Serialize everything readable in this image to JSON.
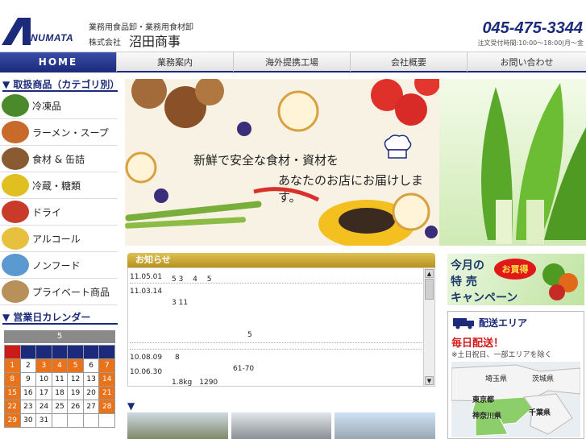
{
  "brand": {
    "logo_text": "NUMATA",
    "tagline": "業務用食品卸・業務用食材卸",
    "company_prefix": "株式会社",
    "company_name": "沼田商事",
    "phone": "045-475-3344",
    "hours": "注文受付時間:10:00～18:00|月～金"
  },
  "nav": [
    "HOME",
    "業務案内",
    "海外提携工場",
    "会社概要",
    "お問い合わせ"
  ],
  "sidebar": {
    "categories_heading": "▼ 取扱商品（カテゴリ別）",
    "categories": [
      {
        "label": "冷凍品",
        "icon": "broccoli-icon",
        "color": "#4a8a2a"
      },
      {
        "label": "ラーメン・スープ",
        "icon": "ramen-bowl-icon",
        "color": "#c86a2a"
      },
      {
        "label": "食材 & 缶詰",
        "icon": "mushroom-icon",
        "color": "#8a5a32"
      },
      {
        "label": "冷蔵・糖類",
        "icon": "lemon-icon",
        "color": "#e0c020"
      },
      {
        "label": "ドライ",
        "icon": "bowl-icon",
        "color": "#c83a2a"
      },
      {
        "label": "アルコール",
        "icon": "beer-glass-icon",
        "color": "#e8c040"
      },
      {
        "label": "ノンフード",
        "icon": "package-icon",
        "color": "#5a9ad0"
      },
      {
        "label": "プライベート商品",
        "icon": "box-icon",
        "color": "#b8905a"
      }
    ],
    "calendar_heading": "▼ 営業日カレンダー",
    "calendar": {
      "month": "5",
      "weeks": [
        [
          "1",
          "2",
          "3",
          "4",
          "5",
          "6",
          "7"
        ],
        [
          "8",
          "9",
          "10",
          "11",
          "12",
          "13",
          "14"
        ],
        [
          "15",
          "16",
          "17",
          "18",
          "19",
          "20",
          "21"
        ],
        [
          "22",
          "23",
          "24",
          "25",
          "26",
          "27",
          "28"
        ],
        [
          "29",
          "30",
          "31",
          "",
          "",
          "",
          ""
        ]
      ],
      "holidays": [
        "1",
        "3",
        "4",
        "5",
        "7",
        "8",
        "14",
        "15",
        "21",
        "22",
        "28",
        "29"
      ]
    }
  },
  "hero": {
    "line1": "新鮮で安全な食材・資材を",
    "line2": "あなたのお店にお届けします。"
  },
  "news": {
    "heading": "お知らせ",
    "items": [
      {
        "date": "11.05.01",
        "text": "5 3　 4　 5"
      },
      {
        "date": "11.03.14",
        "text": ""
      },
      {
        "date": "",
        "text": "3 11"
      },
      {
        "date": "",
        "text": "5"
      },
      {
        "date": "10.08.09",
        "text": "8"
      },
      {
        "date": "",
        "text": "61-70"
      },
      {
        "date": "10.06.30",
        "text": ""
      },
      {
        "date": "",
        "text": "1.8kg　1290"
      }
    ]
  },
  "campaign": {
    "line1": "今月の",
    "line2": "特 売",
    "line3": "キャンペーン",
    "badge": "お買得"
  },
  "delivery": {
    "title": "配送エリア",
    "daily": "毎日配送！",
    "note": "※土日祝日、一部エリアを除く",
    "map_labels": [
      "埼玉県",
      "茨城県",
      "東京都",
      "千葉県",
      "神奈川県"
    ]
  },
  "bottom_arrow": "▼"
}
